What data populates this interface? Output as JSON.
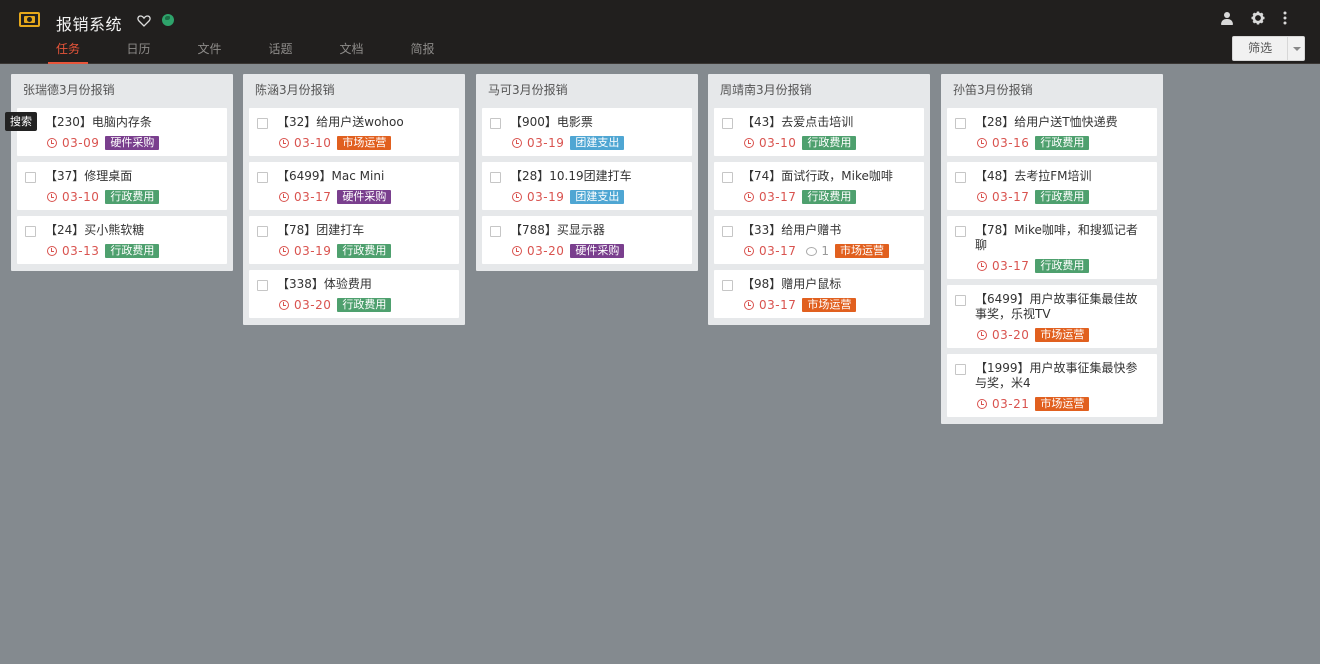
{
  "app": {
    "title": "报销系统",
    "logo_icon": "money-icon"
  },
  "tabs": [
    {
      "label": "任务",
      "active": true
    },
    {
      "label": "日历",
      "active": false
    },
    {
      "label": "文件",
      "active": false
    },
    {
      "label": "话题",
      "active": false
    },
    {
      "label": "文档",
      "active": false
    },
    {
      "label": "简报",
      "active": false
    }
  ],
  "filter": {
    "label": "筛选"
  },
  "tooltip": {
    "text": "搜索"
  },
  "colors": {
    "accent": "#e8553a",
    "header_bg": "#211f1e",
    "board_bg": "#848a8f",
    "due": "#d9534f"
  },
  "tag_colors": {
    "硬件采购": "#7a3f8e",
    "行政费用": "#4ea06e",
    "市场运营": "#e1601f",
    "团建支出": "#4fa6d3"
  },
  "columns": [
    {
      "title": "张瑞德3月份报销",
      "cards": [
        {
          "title": "【230】电脑内存条",
          "date": "03-09",
          "tag": "硬件采购"
        },
        {
          "title": "【37】修理桌面",
          "date": "03-10",
          "tag": "行政费用"
        },
        {
          "title": "【24】买小熊软糖",
          "date": "03-13",
          "tag": "行政费用"
        }
      ]
    },
    {
      "title": "陈涵3月份报销",
      "cards": [
        {
          "title": "【32】给用户送wohoo",
          "date": "03-10",
          "tag": "市场运营"
        },
        {
          "title": "【6499】Mac Mini",
          "date": "03-17",
          "tag": "硬件采购"
        },
        {
          "title": "【78】团建打车",
          "date": "03-19",
          "tag": "行政费用"
        },
        {
          "title": "【338】体验费用",
          "date": "03-20",
          "tag": "行政费用"
        }
      ]
    },
    {
      "title": "马可3月份报销",
      "cards": [
        {
          "title": "【900】电影票",
          "date": "03-19",
          "tag": "团建支出"
        },
        {
          "title": "【28】10.19团建打车",
          "date": "03-19",
          "tag": "团建支出"
        },
        {
          "title": "【788】买显示器",
          "date": "03-20",
          "tag": "硬件采购"
        }
      ]
    },
    {
      "title": "周靖南3月份报销",
      "cards": [
        {
          "title": "【43】去爱点击培训",
          "date": "03-10",
          "tag": "行政费用"
        },
        {
          "title": "【74】面试行政，Mike咖啡",
          "date": "03-17",
          "tag": "行政费用"
        },
        {
          "title": "【33】给用户赠书",
          "date": "03-17",
          "comments": "1",
          "tag": "市场运营"
        },
        {
          "title": "【98】赠用户鼠标",
          "date": "03-17",
          "tag": "市场运营"
        }
      ]
    },
    {
      "title": "孙笛3月份报销",
      "cards": [
        {
          "title": "【28】给用户送T恤快递费",
          "date": "03-16",
          "tag": "行政费用"
        },
        {
          "title": "【48】去考拉FM培训",
          "date": "03-17",
          "tag": "行政费用"
        },
        {
          "title": "【78】Mike咖啡，和搜狐记者聊",
          "date": "03-17",
          "tag": "行政费用"
        },
        {
          "title": "【6499】用户故事征集最佳故事奖，乐视TV",
          "date": "03-20",
          "tag": "市场运营"
        },
        {
          "title": "【1999】用户故事征集最快参与奖，米4",
          "date": "03-21",
          "tag": "市场运营"
        }
      ]
    }
  ]
}
